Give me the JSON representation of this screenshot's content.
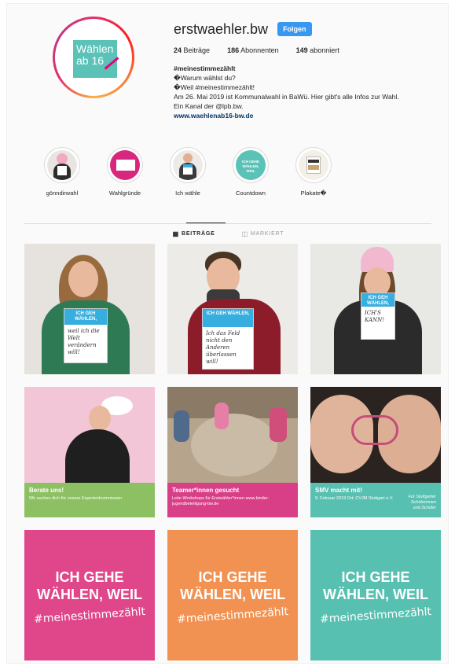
{
  "profile": {
    "avatar_text": [
      "Wählen",
      "ab 16"
    ],
    "username": "erstwaehler.bw",
    "follow_label": "Folgen",
    "stats": {
      "posts_count": "24",
      "posts_label": "Beiträge",
      "followers_count": "186",
      "followers_label": "Abonnenten",
      "following_count": "149",
      "following_label": "abonniert"
    },
    "bio": {
      "hashtag": "#meinestimmezählt",
      "line1": "�Warum wählst du?",
      "line2": "�Weil #meinestimmezählt!",
      "line3": "Am 26. Mai 2019 ist Kommunalwahl in BaWü. Hier gibt's alle Infos zur Wahl.",
      "line4": "Ein Kanal der @lpb.bw.",
      "link": "www.waehlenab16-bw.de"
    }
  },
  "highlights": [
    {
      "label": "gönndirwahl"
    },
    {
      "label": "Wahlgründe"
    },
    {
      "label": "Ich wähle"
    },
    {
      "label": "Countdown",
      "badge_text": "ICH GEHE WÄHLEN, WEIL"
    },
    {
      "label": "Plakate�"
    }
  ],
  "tabs": {
    "posts": {
      "label": "BEITRÄGE",
      "icon": "grid-icon"
    },
    "tagged": {
      "label": "MARKIERT",
      "icon": "tag-icon"
    }
  },
  "posts": {
    "p1": {
      "sign_top": "ICH GEH WÄHLEN,",
      "sign_hand": "weil ich die Welt verändern will!"
    },
    "p2": {
      "sign_top": "ICH GEH WÄHLEN,",
      "sign_hand": "Ich das Feld nicht den Anderen überlassen will!"
    },
    "p3": {
      "sign_top": "ICH GEH WÄHLEN,",
      "sign_hand": "ICH'S KANN!"
    },
    "p4": {
      "title": "Berate uns!",
      "sub": "Wir suchen dich für unsere Expertenkommission"
    },
    "p5": {
      "title": "Teamer*innen gesucht",
      "sub": "Leite Workshops für Erstwähler*innen www.kinder-jugendbeteiligung-bw.de"
    },
    "p6": {
      "title": "SMV macht mit!",
      "sub": "9. Februar 2019 Ort: CVJM Stuttgart e.V.",
      "side": "Für Stuttgarter Schülerinnen und Schüler"
    },
    "text_line1": "ICH GEHE",
    "text_line2": "WÄHLEN, WEIL",
    "text_hash": "#meinestimmezählt"
  },
  "colors": {
    "follow_blue": "#3897f0",
    "teal": "#5bc2b8",
    "magenta": "#e0468a",
    "orange": "#f29252",
    "green_banner": "#8cc063",
    "pink_banner": "#d83f87",
    "teal_banner": "#58c0b1"
  }
}
